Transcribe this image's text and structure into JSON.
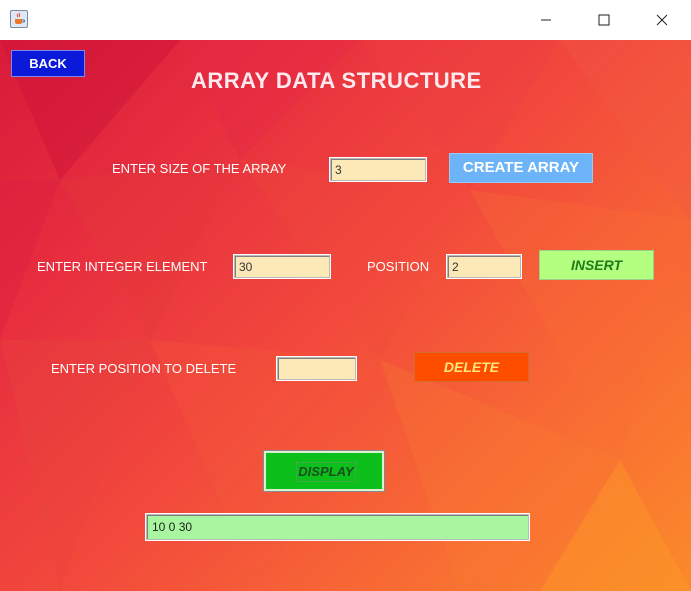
{
  "window": {
    "title": "",
    "icon": "java-cup-icon",
    "controls": [
      "minimize-icon",
      "maximize-icon",
      "close-icon"
    ]
  },
  "header": {
    "title": "ARRAY DATA STRUCTURE",
    "back_label": "BACK"
  },
  "create": {
    "label": "ENTER SIZE OF THE ARRAY",
    "size_value": "3",
    "button_label": "CREATE ARRAY"
  },
  "insert": {
    "element_label": "ENTER INTEGER ELEMENT",
    "element_value": "30",
    "position_label": "POSITION",
    "position_value": "2",
    "button_label": "INSERT"
  },
  "delete": {
    "label": "ENTER POSITION TO DELETE",
    "position_value": "",
    "button_label": "DELETE"
  },
  "display": {
    "button_label": "DISPLAY",
    "output_value": "10 0 30"
  },
  "colors": {
    "background_gradient_start": "#d71b3a",
    "background_gradient_end": "#fb8a2a",
    "back_button": "#0a1ad8",
    "create_button": "#6cb4f7",
    "insert_button": "#b5ff80",
    "delete_button": "#ff4d00",
    "display_button": "#0cbf1a",
    "input_field": "#fde9b8",
    "output_field": "#a8f7a0"
  }
}
